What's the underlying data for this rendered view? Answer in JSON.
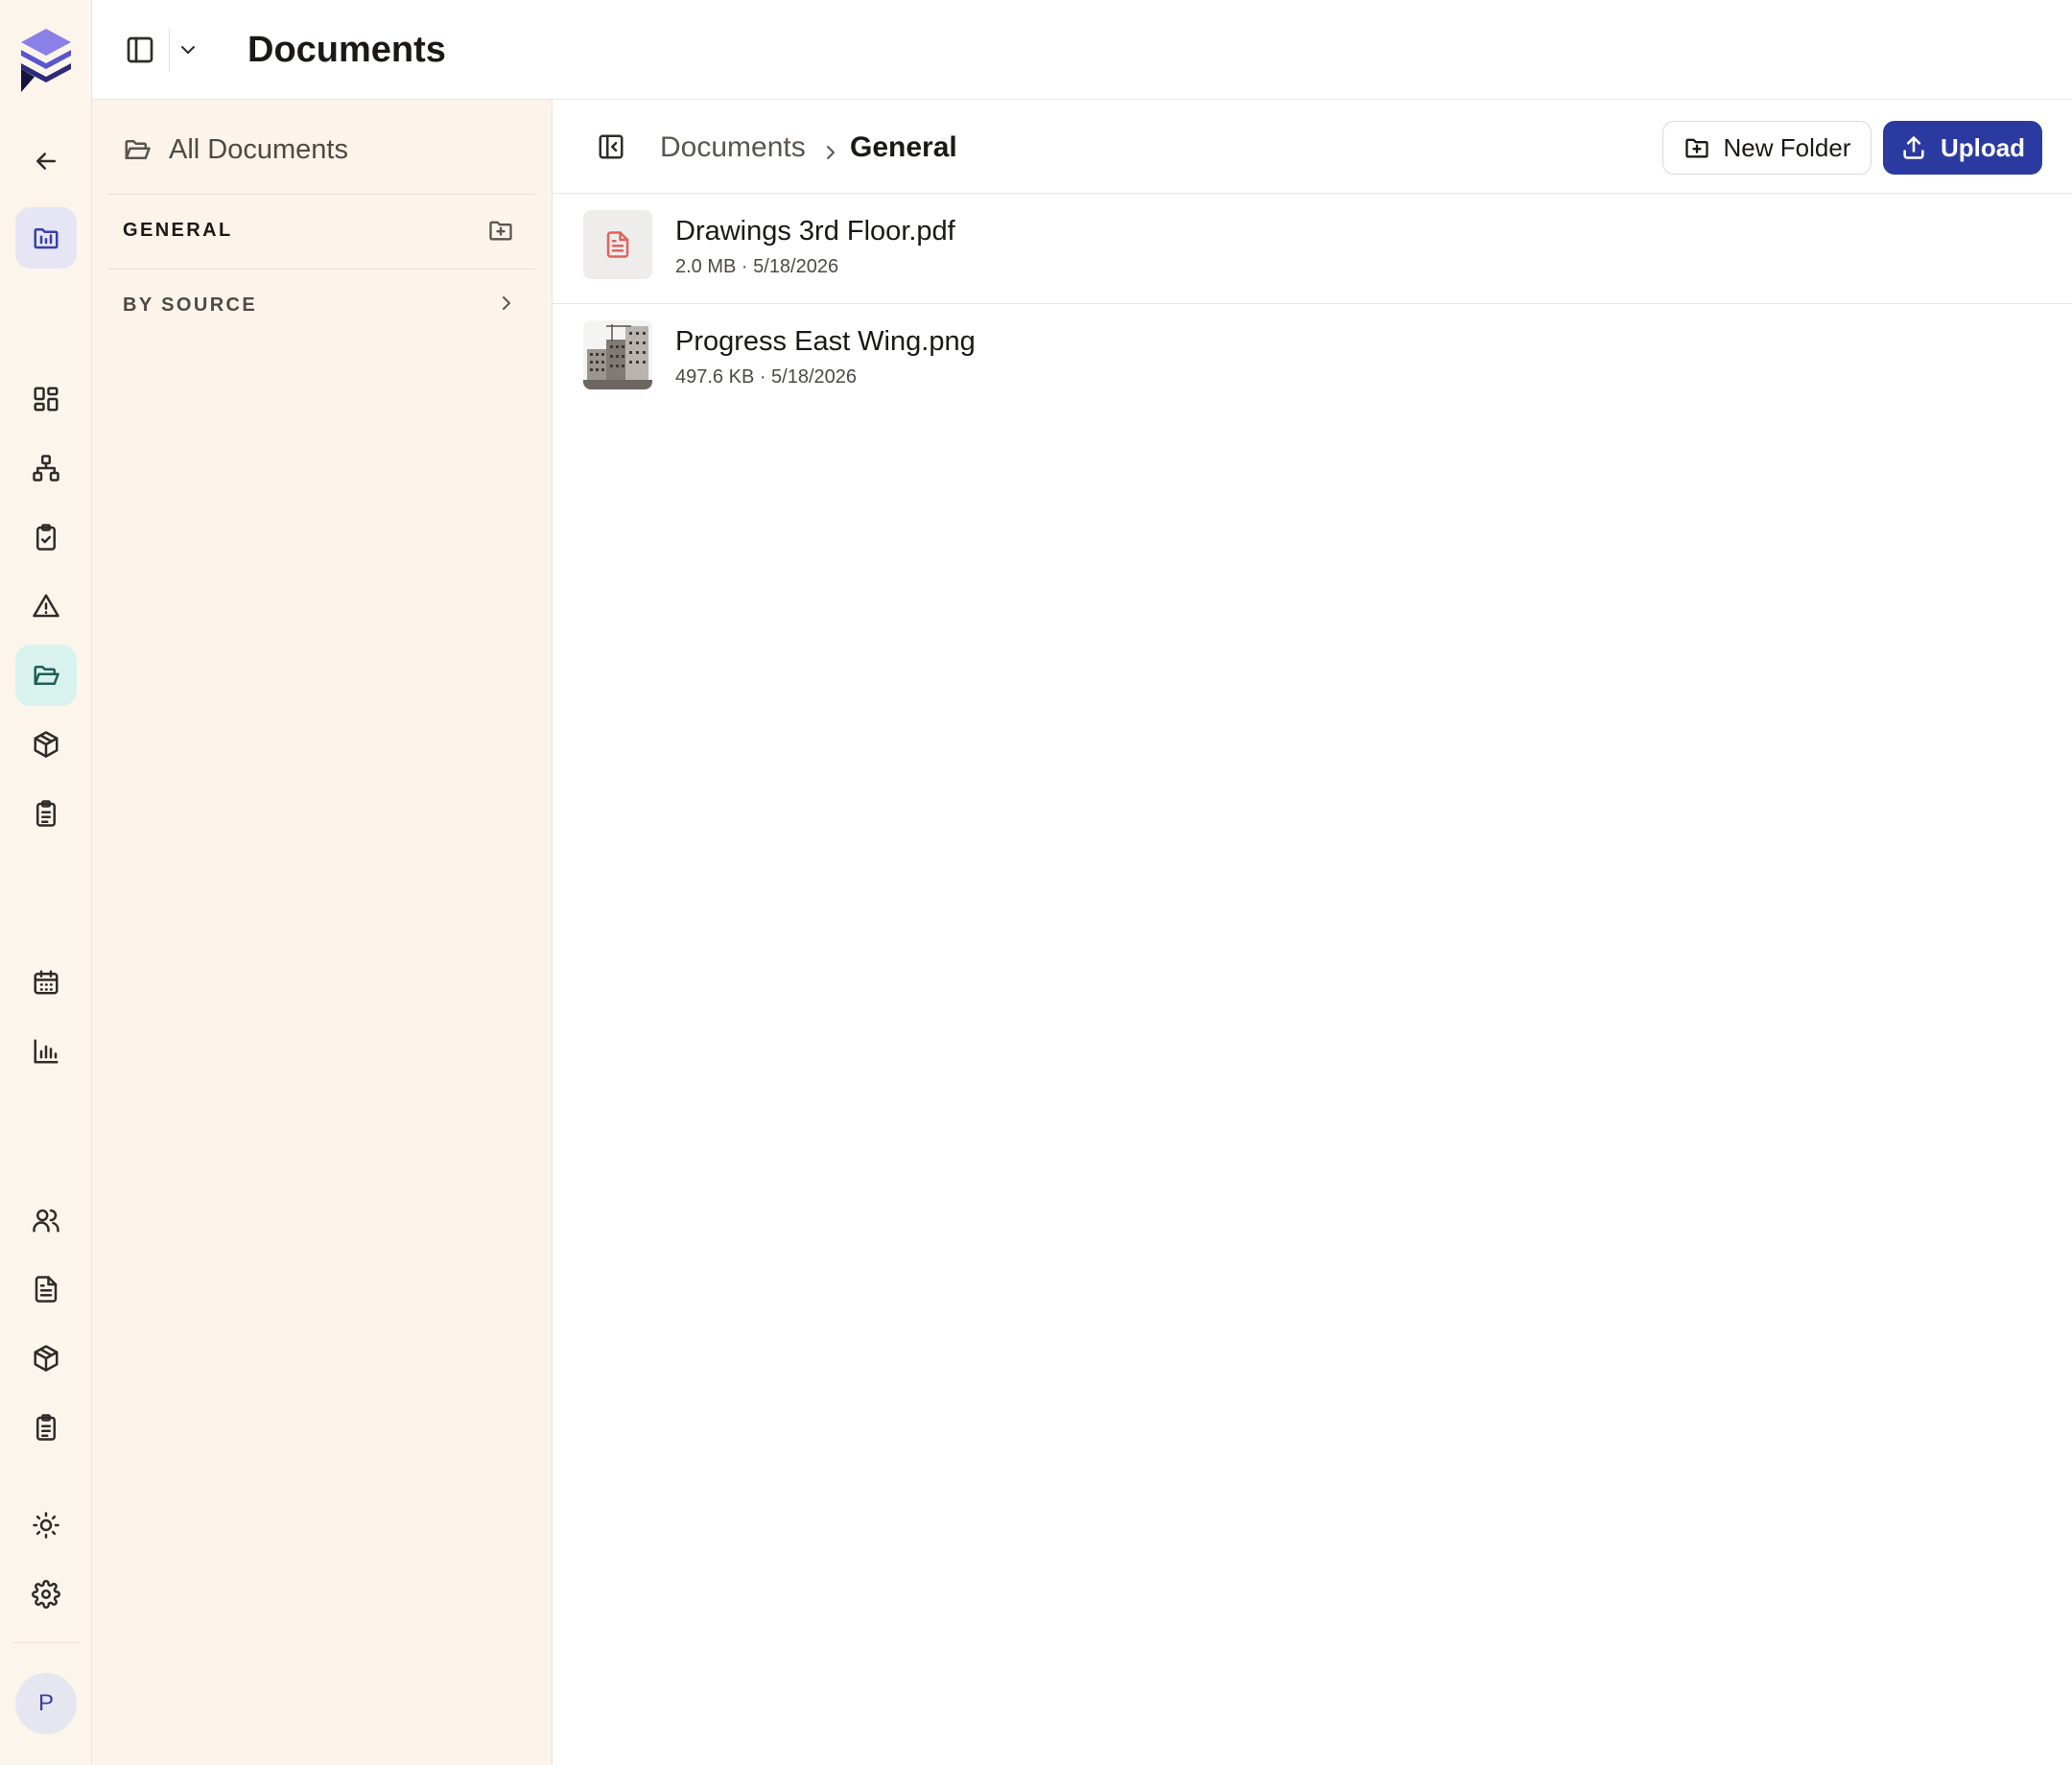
{
  "header": {
    "title": "Documents"
  },
  "rail": {
    "avatar_initial": "P",
    "accent_color": "#3a3fa8",
    "active_color": "#1f5e57"
  },
  "folders": {
    "all_label": "All Documents",
    "sections": [
      {
        "label": "GENERAL",
        "icon": "folder-plus-icon"
      },
      {
        "label": "BY SOURCE",
        "icon": "chevron-right-icon"
      }
    ]
  },
  "breadcrumb": [
    "Documents",
    "General"
  ],
  "actions": {
    "new_folder_label": "New Folder",
    "upload_label": "Upload",
    "upload_color": "#2b3aa0"
  },
  "files": [
    {
      "name": "Drawings 3rd Floor.pdf",
      "meta": "2.0 MB · 5/18/2026",
      "kind": "pdf"
    },
    {
      "name": "Progress East Wing.png",
      "meta": "497.6 KB · 5/18/2026",
      "kind": "image"
    }
  ]
}
